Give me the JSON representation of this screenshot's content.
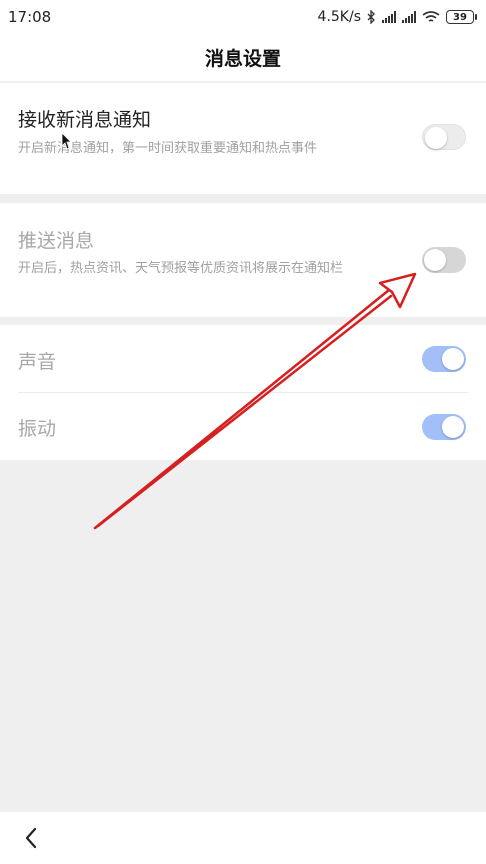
{
  "status_bar": {
    "time": "17:08",
    "speed": "4.5K/s",
    "battery": "39",
    "icons": [
      "bluetooth-icon",
      "signal-icon",
      "signal-icon",
      "wifi-icon",
      "battery-icon"
    ]
  },
  "header": {
    "title": "消息设置"
  },
  "settings": {
    "receive": {
      "title": "接收新消息通知",
      "desc": "开启新消息通知，第一时间获取重要通知和热点事件",
      "state": "off"
    },
    "push": {
      "title": "推送消息",
      "desc": "开启后，热点资讯、天气预报等优质资讯将展示在通知栏",
      "state": "off"
    },
    "sound": {
      "title": "声音",
      "state": "on"
    },
    "vibrate": {
      "title": "振动",
      "state": "on"
    }
  },
  "colors": {
    "toggle_on": "#a3bff7",
    "toggle_off": "#d6d6d6",
    "annotation": "#d61f1f",
    "background": "#efefef"
  },
  "bottom_bar": {
    "icons": [
      "back-icon"
    ]
  }
}
